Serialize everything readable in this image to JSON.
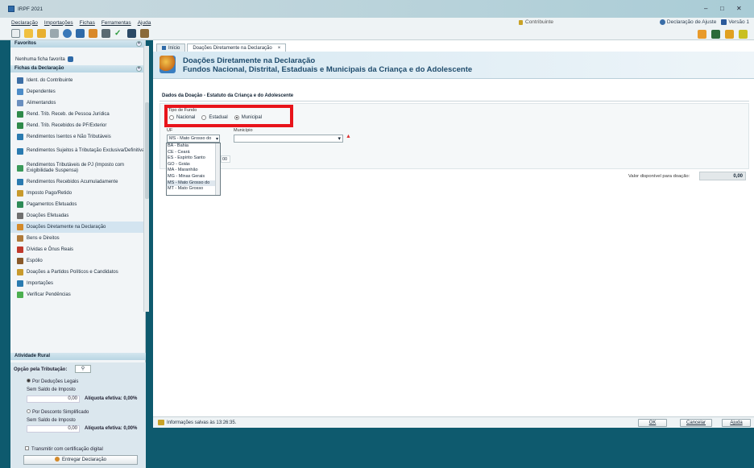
{
  "window": {
    "title": "IRPF 2021",
    "controls": [
      "–",
      "□",
      "✕"
    ]
  },
  "menu": [
    "Declaração",
    "Importações",
    "Fichas",
    "Ferramentas",
    "Ajuda"
  ],
  "contribuinte": "Contribuinte",
  "top_links": {
    "ajuste": "Declaração de Ajuste",
    "versao": "Versão 1"
  },
  "sidebar": {
    "favoritos_header": "Favoritos",
    "favoritos_empty": "Nenhuma ficha favorita",
    "fichas_header": "Fichas da Declaração",
    "items": [
      {
        "label": "Ident. do Contribuinte",
        "color": "#3c6fa6"
      },
      {
        "label": "Dependentes",
        "color": "#4c8cc8"
      },
      {
        "label": "Alimentandos",
        "color": "#6a8fbf"
      },
      {
        "label": "Rend. Trib. Receb. de Pessoa Jurídica",
        "color": "#2f8a4a"
      },
      {
        "label": "Rend. Trib. Recebidos de PF/Exterior",
        "color": "#2f8a4a"
      },
      {
        "label": "Rendimentos Isentos e Não Tributáveis",
        "color": "#2a7bb0"
      },
      {
        "label": "Rendimentos Sujeitos à Tributação Exclusiva/Definitiva",
        "color": "#2a7bb0"
      },
      {
        "label": "Rendimentos Tributáveis de PJ (Imposto com Exigibilidade Suspensa)",
        "color": "#3a9a5a"
      },
      {
        "label": "Rendimentos Recebidos Acumuladamente",
        "color": "#2a7bb0"
      },
      {
        "label": "Imposto Pago/Retido",
        "color": "#c89a2c"
      },
      {
        "label": "Pagamentos Efetuados",
        "color": "#2e8b57"
      },
      {
        "label": "Doações Efetuadas",
        "color": "#6f6f6f"
      },
      {
        "label": "Doações Diretamente na Declaração",
        "color": "#d38a2a"
      },
      {
        "label": "Bens e Direitos",
        "color": "#b07a3a"
      },
      {
        "label": "Dívidas e Ônus Reais",
        "color": "#c0392b"
      },
      {
        "label": "Espólio",
        "color": "#8a5a2a"
      },
      {
        "label": "Doações a Partidos Políticos e Candidatos",
        "color": "#c89a2c"
      },
      {
        "label": "Importações",
        "color": "#2a7bb0"
      },
      {
        "label": "Verificar Pendências",
        "color": "#4caf50"
      }
    ],
    "selected_index": 12,
    "rural_header": "Atividade Rural",
    "opcao_label": "Opção pela Tributação:",
    "deducoes_label": "Por Deduções Legais",
    "sem_saldo_1": "Sem Saldo de Imposto",
    "valor_1": "0,00",
    "aliquota_1": "Alíquota efetiva: 0,00%",
    "simplificado_label": "Por Desconto Simplificado",
    "sem_saldo_2": "Sem Saldo de Imposto",
    "valor_2": "0,00",
    "aliquota_2": "Alíquota efetiva: 0,00%",
    "certificado_label": "Transmitir com certificação digital",
    "entregar_label": "Entregar Declaração"
  },
  "tabs": [
    {
      "label": "Início"
    },
    {
      "label": "Doações Diretamente na Declaração"
    }
  ],
  "header": {
    "title1": "Doações Diretamente na Declaração",
    "title2": "Fundos Nacional, Distrital, Estaduais e Municipais da Criança e do Adolescente"
  },
  "form": {
    "section_title": "Dados da Doação - Estatuto da Criança e do Adolescente",
    "tipo_fundo_label": "Tipo de Fundo",
    "radios": [
      "Nacional",
      "Estadual",
      "Municipal"
    ],
    "radio_selected": 2,
    "uf_label": "UF",
    "municipio_label": "Município",
    "uf_value": "MS - Mato Grosso do",
    "uf_options": [
      "BA - Bahia",
      "CE - Ceará",
      "ES - Espírito Santo",
      "GO - Goiás",
      "MA - Maranhão",
      "MG - Minas Gerais",
      "MS - Mato Grosso do",
      "MT - Mato Grosso"
    ],
    "uf_highlight": 6,
    "value_partial": "00",
    "valor_disponivel_label": "Valor disponível para doação:",
    "valor_disponivel": "0,00"
  },
  "status": {
    "text": "Informações salvas às 13:26:35."
  },
  "buttons": {
    "ok": "OK",
    "cancelar": "Cancelar",
    "ajuda": "Ajuda"
  }
}
